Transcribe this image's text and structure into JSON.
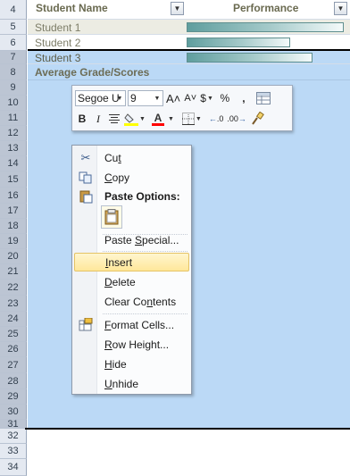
{
  "row_numbers": [
    "4",
    "5",
    "6",
    "7",
    "8",
    "9",
    "10",
    "11",
    "12",
    "13",
    "14",
    "15",
    "16",
    "17",
    "18",
    "19",
    "20",
    "21",
    "22",
    "23",
    "24",
    "25",
    "26",
    "27",
    "28",
    "29",
    "30",
    "31",
    "32",
    "33",
    "34"
  ],
  "table": {
    "col1_header": "Student Name",
    "col2_header": "Performance",
    "filter_glyph": "▼",
    "students": [
      {
        "name": "Student 1",
        "performance": 1.0
      },
      {
        "name": "Student 2",
        "performance": 0.66
      },
      {
        "name": "Student 3",
        "performance": 0.8
      }
    ]
  },
  "section_title": "Average Grade/Scores",
  "mini_toolbar": {
    "font_name": "Segoe U",
    "font_size": "9",
    "grow_font": "A˄",
    "shrink_font": "A˅",
    "currency": "$",
    "percent": "%",
    "comma": ",",
    "bold": "B",
    "italic": "I",
    "decrease_decimal": ".00",
    "increase_decimal": ".0",
    "font_color_letter": "A",
    "highlight_color": "#ffff00",
    "font_color": "#ff0000"
  },
  "context_menu": {
    "items": [
      {
        "label": "Cut",
        "icon": "scissors-icon"
      },
      {
        "label": "Copy",
        "icon": "copy-icon"
      },
      {
        "label": "Paste Options:",
        "icon": "paste-icon"
      },
      {
        "label": "Paste Special...",
        "icon": ""
      },
      {
        "label": "Insert",
        "icon": ""
      },
      {
        "label": "Delete",
        "icon": ""
      },
      {
        "label": "Clear Contents",
        "icon": ""
      },
      {
        "label": "Format Cells...",
        "icon": "format-cells-icon"
      },
      {
        "label": "Row Height...",
        "icon": ""
      },
      {
        "label": "Hide",
        "icon": ""
      },
      {
        "label": "Unhide",
        "icon": ""
      }
    ],
    "highlighted": "Insert"
  }
}
